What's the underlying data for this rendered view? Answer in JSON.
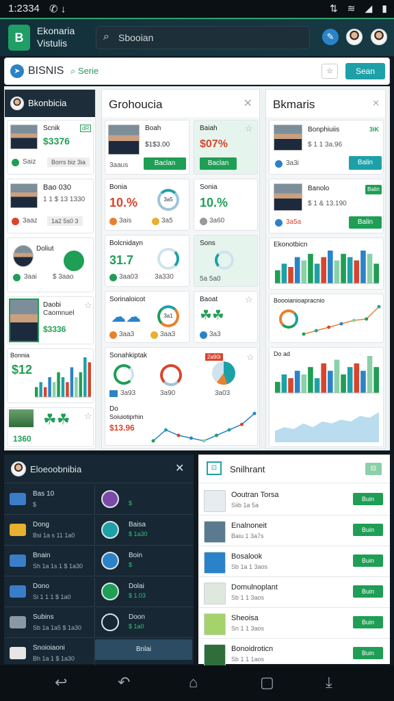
{
  "status": {
    "time": "1:2334",
    "icons": [
      "✆",
      "↓"
    ],
    "right": [
      "⇅",
      "wifi",
      "signal",
      "battery"
    ]
  },
  "header": {
    "logo": "B",
    "app_line1": "Ekonaria",
    "app_line2": "Vistulis",
    "search_placeholder": "Sbooian",
    "search_icon": "search-icon"
  },
  "topbar": {
    "title": "BISNIS",
    "search_label": "Serie",
    "button": "Sean",
    "icon_btn": "☆"
  },
  "columns": {
    "left": {
      "title": "Bkonbicia"
    },
    "mid": {
      "title": "Grohoucia"
    },
    "right": {
      "title": "Bkmaris"
    }
  },
  "left_cards": [
    {
      "name": "Scnik",
      "tag": "dR",
      "value": "$3376",
      "meta1": "Saiz",
      "meta2": "Borrs biz 3ia"
    },
    {
      "name": "Bao 030",
      "sub": "1 1 $ 13 1330",
      "meta1": "3aaz",
      "meta2": "1a2 5s0 3"
    },
    {
      "name": "Doliut",
      "meta1": "3aai",
      "meta2": "$ 3aao"
    },
    {
      "name": "Daobi",
      "sub": "Caomnuel",
      "value": "$3336"
    },
    {
      "name": "Bonnia",
      "value": "$12"
    },
    {
      "value": "1360"
    }
  ],
  "mid_cards": [
    {
      "name": "Boah",
      "value": "$1$3.00",
      "button": "Baclan",
      "meta": "3aaus"
    },
    {
      "name": "Baiah",
      "value": "$07%",
      "button": "Baclan"
    },
    {
      "name": "Bonia",
      "value": "10.%",
      "ring": "3a5",
      "meta1": "3ais",
      "meta2": "3a5"
    },
    {
      "name": "Sonia",
      "value": "10.%",
      "meta1": "3a60"
    },
    {
      "name": "Bolcnidayn",
      "value": "31.7",
      "meta1": "3aa03",
      "meta2": "3a330"
    },
    {
      "name": "Sons",
      "meta1": "5a 5a0"
    },
    {
      "name": "Sorinaloicot",
      "ring": "3a1",
      "meta1": "3aa3",
      "meta2": "3aa3"
    },
    {
      "name": "Baoat",
      "meta1": "3a3"
    },
    {
      "name": "Sonahkiptak",
      "tag": "2a90i",
      "meta1": "3a93",
      "meta2": "3a90",
      "meta3": "3a03"
    },
    {
      "name": "Do",
      "sub": "Soiuiotiprhin",
      "value": "$13.96"
    }
  ],
  "right_cards": [
    {
      "name": "Bonphiuiis",
      "tag": "3iK",
      "sub": "$ 1 1 3a.96",
      "meta": "3a3i",
      "button": "Balin"
    },
    {
      "name": "Banolo",
      "sub": "$ 1 & 13.190",
      "meta": "3a5a",
      "button": "Balin",
      "tag": "Balin"
    },
    {
      "name": "Ekonotbicn"
    },
    {
      "name": "Boooianioapracnio"
    },
    {
      "name": "Do ad"
    }
  ],
  "chart_data": [
    {
      "type": "bar",
      "title": "Ekonotbicn",
      "values": [
        4,
        6,
        5,
        8,
        7,
        9,
        6,
        8,
        10,
        7,
        9,
        8,
        7,
        10,
        9,
        6
      ]
    },
    {
      "type": "line",
      "title": "Boooianioapracnio",
      "values": [
        2,
        2.5,
        3,
        3.5,
        4,
        4.2,
        6
      ]
    },
    {
      "type": "bar",
      "title": "Do ad",
      "values": [
        3,
        5,
        4,
        6,
        5,
        7,
        4,
        8,
        6,
        9,
        5,
        7,
        8,
        6,
        10,
        7
      ]
    },
    {
      "type": "area",
      "values": [
        3,
        4,
        3.5,
        5,
        4,
        5.5,
        5,
        6,
        5.5,
        7,
        6.5,
        8
      ]
    },
    {
      "type": "bar",
      "title": "Bonnia",
      "values": [
        2,
        3,
        2,
        4,
        3,
        5,
        4,
        3,
        6,
        4,
        5,
        8,
        7
      ]
    },
    {
      "type": "line",
      "values": [
        3,
        5,
        4,
        3.5,
        3,
        4,
        5,
        6,
        8
      ]
    }
  ],
  "bottom_left": {
    "title": "Eloeoobnibia",
    "rows_left": [
      {
        "t": "Bas 10",
        "s": "$"
      },
      {
        "t": "Dong",
        "s": "Bsi 1a s 11 1a0"
      },
      {
        "t": "Bnain",
        "s": "Sh 1a 1s 1 $ 1a30"
      },
      {
        "t": "Dono",
        "s": "Si 1 1 1 $ 1a0"
      },
      {
        "t": "Subins",
        "s": "Sb 1a 1a5 $ 1a30"
      },
      {
        "t": "Snoioiaoni",
        "s": "Bh 1a 1 $ 1a30"
      }
    ],
    "rows_right": [
      {
        "t": "",
        "s": "$"
      },
      {
        "t": "Baisa",
        "s": "$ 1a30"
      },
      {
        "t": "Boin",
        "s": "$"
      },
      {
        "t": "Dolai",
        "s": "$ 1.03"
      },
      {
        "t": "Doon",
        "s": "$ 1a0"
      }
    ],
    "button": "Bnlai"
  },
  "bottom_right": {
    "title": "Snilhrant",
    "rows": [
      {
        "t": "Ooutran Torsa",
        "s": "Siib 1a 5a",
        "b": "Buin"
      },
      {
        "t": "Enalnoneit",
        "s": "Baiu 1 3a7s",
        "b": "Buin"
      },
      {
        "t": "Bosalook",
        "s": "Sb 1a 1 3aos",
        "b": "Buin"
      },
      {
        "t": "Domulnoplant",
        "s": "Sb 1 1 3aos",
        "b": "Buin"
      },
      {
        "t": "Sheoisa",
        "s": "Sn 1 1 3aos",
        "b": "Buin"
      },
      {
        "t": "Bonoidroticn",
        "s": "Sb 1 1 1aos",
        "b": "Buin"
      }
    ]
  },
  "colors": {
    "green": "#1f9e55",
    "teal": "#1ea0a8",
    "red": "#d9442c",
    "blue": "#2a83c9",
    "dark": "#172733"
  }
}
